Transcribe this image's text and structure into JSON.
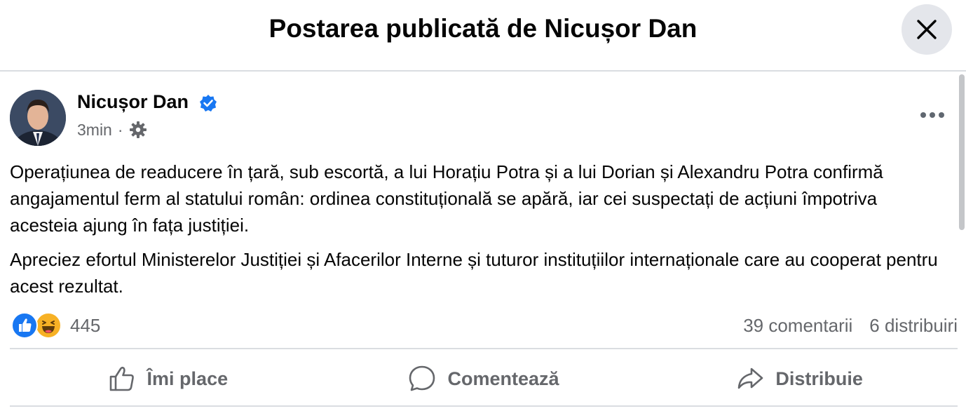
{
  "dialog": {
    "title": "Postarea publicată de Nicușor Dan",
    "close_icon": "close-icon"
  },
  "post": {
    "author": "Nicușor Dan",
    "verified": true,
    "time": "3min",
    "separator": "·",
    "audience_icon": "gear-icon",
    "paragraphs": [
      "Operațiunea de readucere în țară, sub escortă, a lui Horațiu Potra și a lui Dorian și Alexandru Potra confirmă angajamentul ferm al statului român: ordinea constituțională se apără, iar cei suspectați de acțiuni împotriva acesteia ajung în fața justiției.",
      "Apreciez efortul Ministerelor Justiției și Afacerilor Interne și tuturor instituțiilor internaționale care au cooperat pentru acest rezultat."
    ],
    "reactions": {
      "icons": [
        "like-icon",
        "haha-icon"
      ],
      "count": "445"
    },
    "comments": "39 comentarii",
    "shares": "6 distribuiri"
  },
  "actions": {
    "like": "Îmi place",
    "comment": "Comentează",
    "share": "Distribuie"
  },
  "colors": {
    "verified_blue": "#1877f2",
    "secondary_text": "#65676b",
    "divider": "#dadde1",
    "close_bg": "#e4e6eb"
  }
}
